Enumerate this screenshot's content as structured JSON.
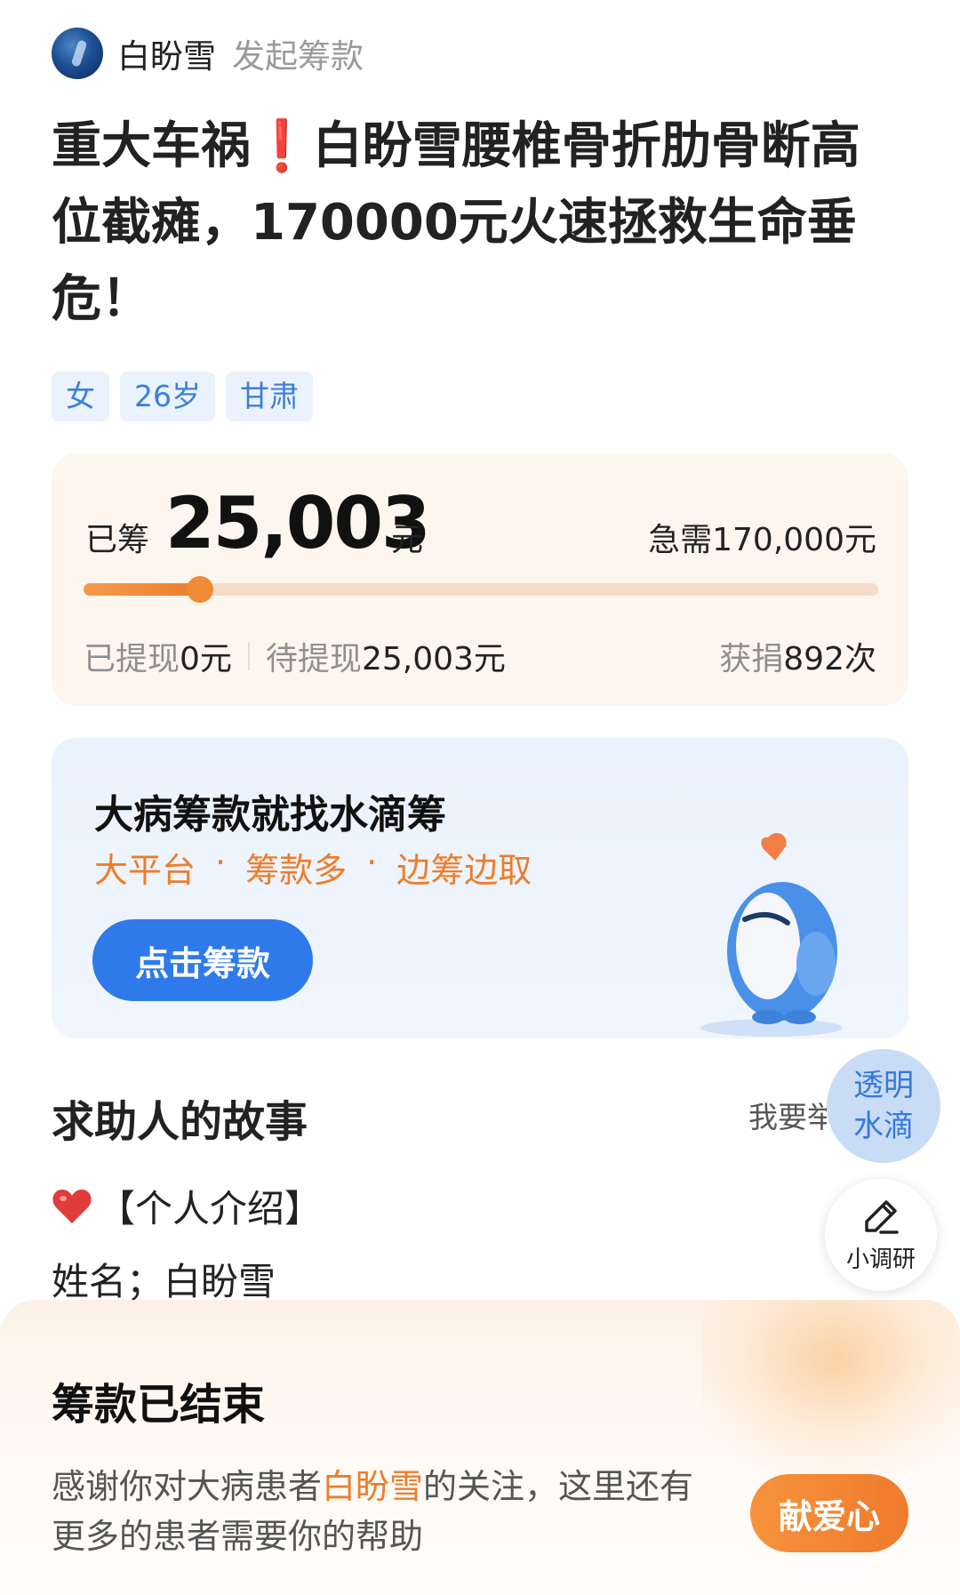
{
  "header": {
    "author_name": "白盼雪",
    "action_text": "发起筹款"
  },
  "title": "重大车祸❗白盼雪腰椎骨折肋骨断高位截瘫，170000元火速拯救生命垂危！",
  "tags": [
    "女",
    "26岁",
    "甘肃"
  ],
  "progress": {
    "raised_label": "已筹",
    "raised_amount": "25,003",
    "raised_unit": "元",
    "needed_label": "急需",
    "needed_amount": "170,000元",
    "fraction": 0.147,
    "withdrawn_label": "已提现",
    "withdrawn_value": "0元",
    "pending_label": "待提现",
    "pending_value": "25,003元",
    "donations_label": "获捐",
    "donations_value": "892次"
  },
  "promo": {
    "title": "大病筹款就找水滴筹",
    "features": [
      "大平台",
      "·",
      "筹款多",
      "·",
      "边筹边取"
    ],
    "button_label": "点击筹款"
  },
  "story": {
    "section_title": "求助人的故事",
    "report_link": "我要举报",
    "intro_heading": "【个人介绍】",
    "name_line": "姓名；白盼雪"
  },
  "floating": {
    "transparent_line1": "透明",
    "transparent_line2": "水滴",
    "survey_label": "小调研"
  },
  "bottom_sheet": {
    "title": "筹款已结束",
    "message_prefix": "感谢你对大病患者",
    "message_name": "白盼雪",
    "message_suffix": "的关注，这里还有更多的患者需要你的帮助",
    "donate_button": "献爱心"
  },
  "colors": {
    "accent_orange": "#ee7d2a",
    "accent_blue": "#2f7aea",
    "tag_blue": "#3d7fd9"
  },
  "icons": [
    "heart-icon",
    "edit-pen-icon",
    "mascot-illustration"
  ]
}
